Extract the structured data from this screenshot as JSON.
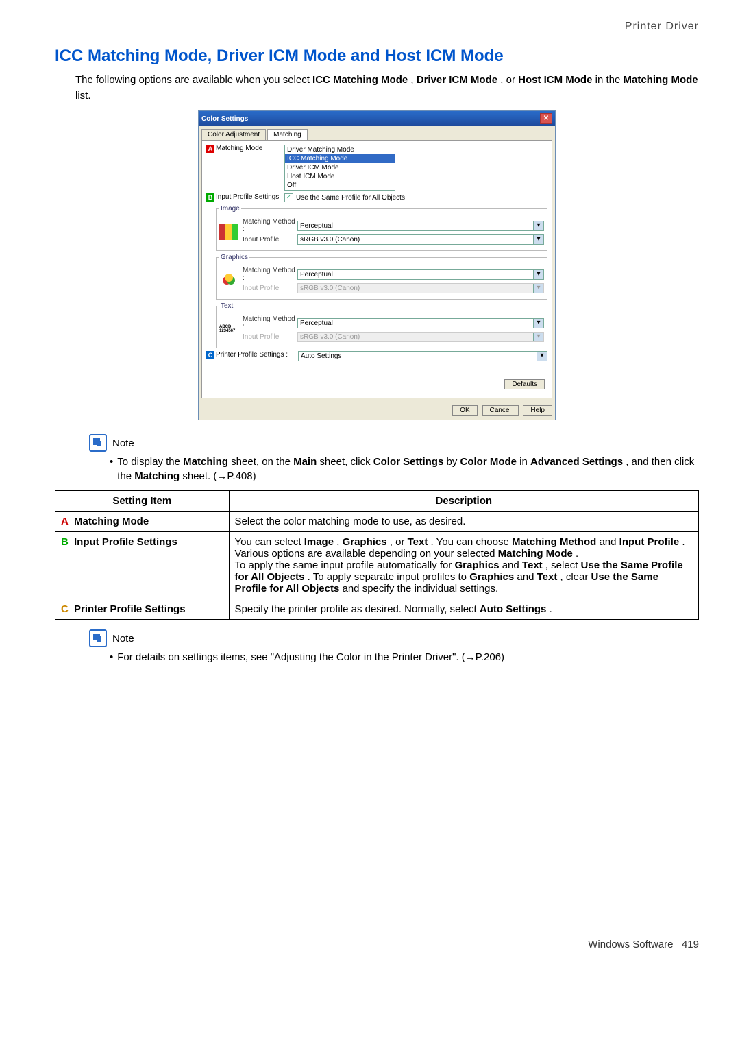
{
  "header": {
    "right": "Printer Driver"
  },
  "title": "ICC Matching Mode, Driver ICM Mode and Host ICM Mode",
  "intro": {
    "pre": "The following options are available when you select ",
    "b1": "ICC Matching Mode",
    "mid1": ", ",
    "b2": "Driver ICM Mode",
    "mid2": ", or ",
    "b3": "Host ICM Mode",
    "mid3": " in the ",
    "b4": "Matching Mode",
    "post": " list."
  },
  "dialog": {
    "title": "Color Settings",
    "tabs": {
      "t1": "Color Adjustment",
      "t2": "Matching"
    },
    "matching_label": "Matching Mode",
    "matching_options": [
      "Driver Matching Mode",
      "ICC Matching Mode",
      "Driver ICM Mode",
      "Host ICM Mode",
      "Off"
    ],
    "input_profile_label": "Input Profile Settings",
    "same_profile": "Use the Same Profile for All Objects",
    "groups": {
      "image": {
        "legend": "Image",
        "mm_label": "Matching Method :",
        "mm_val": "Perceptual",
        "ip_label": "Input Profile :",
        "ip_val": "sRGB v3.0 (Canon)"
      },
      "graphics": {
        "legend": "Graphics",
        "mm_label": "Matching Method :",
        "mm_val": "Perceptual",
        "ip_label": "Input Profile :",
        "ip_val": "sRGB v3.0 (Canon)"
      },
      "text": {
        "legend": "Text",
        "thumb": "ABCD\n1234567",
        "mm_label": "Matching Method :",
        "mm_val": "Perceptual",
        "ip_label": "Input Profile :",
        "ip_val": "sRGB v3.0 (Canon)"
      }
    },
    "printer_profile_label": "Printer Profile Settings :",
    "printer_profile_val": "Auto Settings",
    "buttons": {
      "defaults": "Defaults",
      "ok": "OK",
      "cancel": "Cancel",
      "help": "Help"
    }
  },
  "note1": {
    "label": "Note",
    "text": "To display the Matching sheet, on the Main sheet, click Color Settings by Color Mode in Advanced Settings, and then click the Matching sheet. (→P.408)"
  },
  "note1_parts": {
    "p0": "To display the ",
    "b1": "Matching",
    "p1": " sheet, on the ",
    "b2": "Main",
    "p2": " sheet, click ",
    "b3": "Color Settings",
    "p3": " by ",
    "b4": "Color Mode",
    "p4": " in ",
    "b5": "Advanced Settings",
    "p5": ", and then click the ",
    "b6": "Matching",
    "p6": " sheet. (→P.408)"
  },
  "table": {
    "h1": "Setting Item",
    "h2": "Description",
    "rowA": {
      "letter": "A",
      "name": "Matching Mode",
      "desc": "Select the color matching mode to use, as desired."
    },
    "rowB": {
      "letter": "B",
      "name": "Input Profile Settings",
      "desc": {
        "p0": "You can select ",
        "b1": "Image",
        "p1": ", ",
        "b2": "Graphics",
        "p2": ", or ",
        "b3": "Text",
        "p3": ". You can choose ",
        "b4": "Matching Method",
        "p4": " and ",
        "b5": "Input Profile",
        "p5": ".",
        "line2a": "Various options are available depending on your selected ",
        "line2b": "Matching Mode",
        "line2c": ".",
        "line3a": "To apply the same input profile automatically for ",
        "line3b": "Graphics",
        "line3c": " and ",
        "line3d": "Text",
        "line3e": ", select ",
        "line3f": "Use the Same Profile for All Objects",
        "line3g": ". To apply separate input profiles to ",
        "line3h": "Graphics",
        "line3i": " and ",
        "line3j": "Text",
        "line3k": ", clear ",
        "line3l": "Use the Same Profile for All Objects",
        "line3m": " and specify the individual settings."
      }
    },
    "rowC": {
      "letter": "C",
      "name": "Printer Profile Settings",
      "desc_a": "Specify the printer profile as desired. Normally, select ",
      "desc_b": "Auto Settings",
      "desc_c": "."
    }
  },
  "note2": {
    "label": "Note",
    "text": "For details on settings items, see \"Adjusting the Color in the Printer Driver\". (→P.206)"
  },
  "footer": {
    "left": "Windows Software",
    "page": "419"
  }
}
